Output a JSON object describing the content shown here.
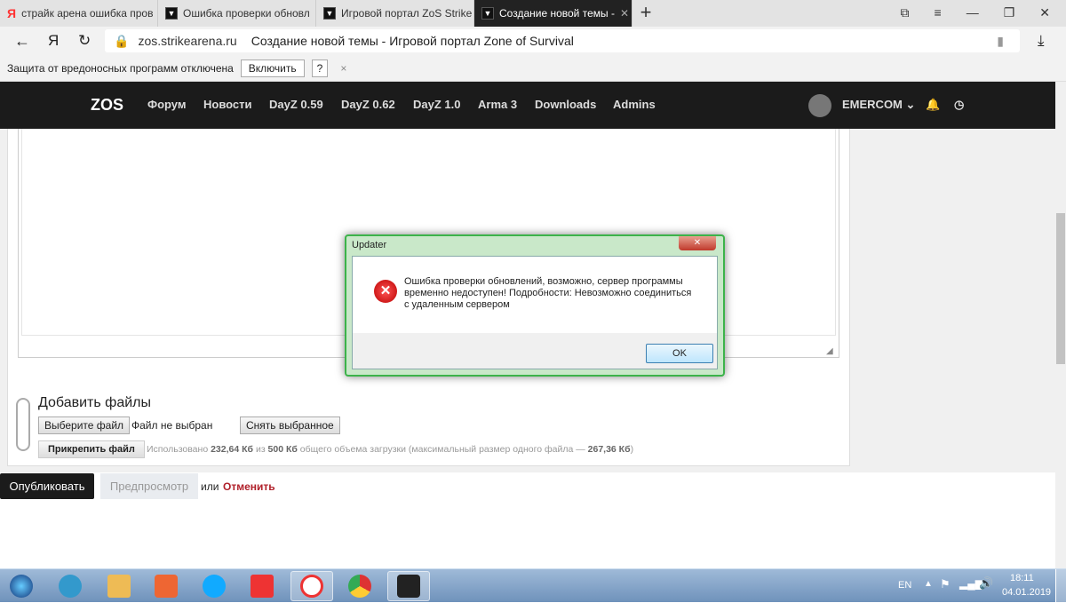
{
  "browser": {
    "tabs": [
      {
        "title": "страйк арена ошибка пров",
        "icon": "yandex-icon"
      },
      {
        "title": "Ошибка проверки обновл",
        "icon": "zos-icon"
      },
      {
        "title": "Игровой портал ZoS Strike",
        "icon": "zos-icon"
      },
      {
        "title": "Создание новой темы -",
        "icon": "zos-icon",
        "active": true
      }
    ],
    "domain": "zos.strikearena.ru",
    "page_title": "Создание новой темы - Игровой портал Zone of Survival",
    "infobar": {
      "text": "Защита от вредоносных программ отключена",
      "enable": "Включить",
      "help": "?",
      "close": "×"
    }
  },
  "nav": {
    "items": [
      "Форум",
      "Новости",
      "DayZ 0.59",
      "DayZ 0.62",
      "DayZ 1.0",
      "Arma 3",
      "Downloads",
      "Admins"
    ],
    "user": "EMERCOM"
  },
  "attach": {
    "title": "Добавить файлы",
    "choose": "Выберите файл",
    "no_file": "Файл не выбран",
    "clear": "Снять выбранное",
    "attach": "Прикрепить файл",
    "usage_pre": "Использовано ",
    "used": "232,64 Кб",
    "of": " из ",
    "total": "500 Кб",
    "usage_mid": " общего объема загрузки (максимальный размер одного файла — ",
    "max": "267,36 Кб",
    "usage_end": ")"
  },
  "actions": {
    "publish": "Опубликовать",
    "preview": "Предпросмотр",
    "or": "или",
    "cancel": "Отменить"
  },
  "dialog": {
    "title": "Updater",
    "close": "✕",
    "message": "Ошибка проверки обновлений, возможно, сервер программы временно недоступен! Подробности: Невозможно соединиться с удаленным сервером",
    "ok": "OK"
  },
  "tray": {
    "lang": "EN",
    "time": "18:11",
    "date": "04.01.2019"
  },
  "colors": {
    "cancel": "#b0202a",
    "nav": "#1b1b1b",
    "dialog_border": "#3cb34a"
  }
}
